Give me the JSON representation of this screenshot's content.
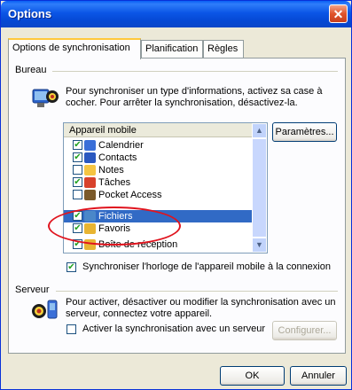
{
  "window": {
    "title": "Options",
    "close": "✕"
  },
  "tabs": [
    {
      "label": "Options de synchronisation"
    },
    {
      "label": "Planification"
    },
    {
      "label": "Règles"
    }
  ],
  "bureau": {
    "label": "Bureau",
    "description_line1": "Pour synchroniser un type d'informations, activez sa case à",
    "description_line2": "cocher. Pour arrêter la synchronisation, désactivez-la.",
    "list_header": "Appareil mobile",
    "items": [
      {
        "label": "Calendrier",
        "checked": true,
        "color": "#3a6fd8"
      },
      {
        "label": "Contacts",
        "checked": true,
        "color": "#2a58c0"
      },
      {
        "label": "Notes",
        "checked": false,
        "color": "#f5c542"
      },
      {
        "label": "Tâches",
        "checked": true,
        "color": "#d8412b"
      },
      {
        "label": "Pocket Access",
        "checked": false,
        "color": "#7b5a2a"
      },
      {
        "label": "Fichiers",
        "checked": true,
        "color": "#4a87c9"
      },
      {
        "label": "Favoris",
        "checked": true,
        "color": "#e8b431"
      },
      {
        "label": "Boîte de réception",
        "checked": true,
        "color": "#e8b431"
      }
    ],
    "settings_button": "Paramètres...",
    "clock_sync_label": "Synchroniser l'horloge de l'appareil mobile à la connexion"
  },
  "serveur": {
    "label": "Serveur",
    "description_line1": "Pour activer, désactiver ou modifier la synchronisation avec un",
    "description_line2": "serveur, connectez votre appareil.",
    "enable_label": "Activer la synchronisation avec un serveur",
    "configure_button": "Configurer..."
  },
  "footer": {
    "ok": "OK",
    "cancel": "Annuler"
  }
}
